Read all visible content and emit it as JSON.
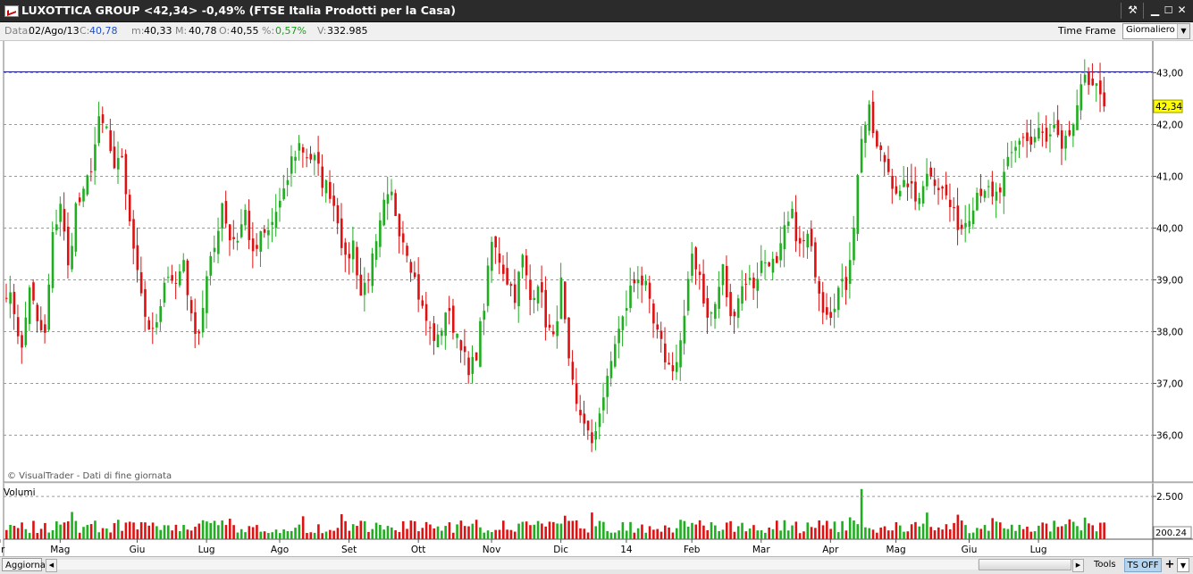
{
  "window": {
    "title": "LUXOTTICA GROUP <42,34> -0,49%  (FTSE Italia Prodotti per la Casa)",
    "buttons": [
      "tools-icon",
      "minimize-icon",
      "maximize-icon",
      "close-icon"
    ]
  },
  "info": {
    "data_label": "Data:",
    "data_value": "02/Ago/13",
    "close_label": "C:",
    "close_value": "40,78",
    "min_label": "m:",
    "min_value": "40,33",
    "max_label": "M:",
    "max_value": "40,78",
    "open_label": "O:",
    "open_value": "40,55",
    "pct_label": "%:",
    "pct_value": "0,57%",
    "vol_label": "V:",
    "vol_value": "332.985",
    "timeframe_label": "Time Frame",
    "timeframe_value": "Giornaliero"
  },
  "bottom": {
    "aggiorna": "Aggiorna",
    "tools": "Tools",
    "tsoff": "TS OFF",
    "plus": "+"
  },
  "chart_data": [
    {
      "type": "candlestick",
      "title": "",
      "ylim": [
        35.1,
        43.6
      ],
      "y_ticks": [
        "43,00",
        "42,00",
        "41,00",
        "40,00",
        "39,00",
        "38,00",
        "37,00",
        "36,00"
      ],
      "y_tick_values": [
        43,
        42,
        41,
        40,
        39,
        38,
        37,
        36
      ],
      "x_ticks": [
        "r",
        "Mag",
        "Giu",
        "Lug",
        "Ago",
        "Set",
        "Ott",
        "Nov",
        "Dic",
        "14",
        "Feb",
        "Mar",
        "Apr",
        "Mag",
        "Giu",
        "Lug"
      ],
      "x_tick_index": [
        0,
        14,
        34,
        52,
        71,
        89,
        107,
        126,
        144,
        161,
        178,
        196,
        214,
        231,
        250,
        268
      ],
      "last_price_label": "42,34",
      "last_price": 42.34,
      "resistance_level": 43.02,
      "grid": true,
      "colors": {
        "up": "#1fae1f",
        "down": "#dd1111",
        "grid": "#9a9a9a",
        "resistance": "#1a1a8c"
      },
      "watermark": "© VisualTrader - Dati di fine giornata",
      "anchors": [
        [
          0,
          38.8
        ],
        [
          2,
          38.4
        ],
        [
          4,
          37.6
        ],
        [
          6,
          38.9
        ],
        [
          8,
          38.1
        ],
        [
          10,
          37.9
        ],
        [
          12,
          39.8
        ],
        [
          14,
          40.5
        ],
        [
          16,
          39.2
        ],
        [
          18,
          40.4
        ],
        [
          20,
          40.6
        ],
        [
          22,
          41.2
        ],
        [
          24,
          42.0
        ],
        [
          26,
          41.9
        ],
        [
          28,
          41.0
        ],
        [
          30,
          41.4
        ],
        [
          32,
          40.0
        ],
        [
          34,
          39.3
        ],
        [
          36,
          38.3
        ],
        [
          38,
          37.9
        ],
        [
          40,
          38.4
        ],
        [
          42,
          39.2
        ],
        [
          44,
          38.9
        ],
        [
          46,
          39.4
        ],
        [
          48,
          38.2
        ],
        [
          50,
          38.0
        ],
        [
          52,
          39.0
        ],
        [
          54,
          39.6
        ],
        [
          56,
          40.5
        ],
        [
          58,
          39.8
        ],
        [
          60,
          39.8
        ],
        [
          62,
          40.3
        ],
        [
          64,
          39.4
        ],
        [
          66,
          39.8
        ],
        [
          68,
          39.9
        ],
        [
          70,
          40.3
        ],
        [
          72,
          40.6
        ],
        [
          74,
          41.3
        ],
        [
          76,
          41.6
        ],
        [
          78,
          41.4
        ],
        [
          80,
          41.3
        ],
        [
          82,
          40.9
        ],
        [
          84,
          40.7
        ],
        [
          86,
          40.2
        ],
        [
          88,
          39.3
        ],
        [
          90,
          39.7
        ],
        [
          92,
          38.7
        ],
        [
          94,
          39.1
        ],
        [
          96,
          39.6
        ],
        [
          98,
          40.4
        ],
        [
          100,
          40.6
        ],
        [
          102,
          40.0
        ],
        [
          104,
          39.6
        ],
        [
          106,
          39.0
        ],
        [
          108,
          38.4
        ],
        [
          110,
          38.0
        ],
        [
          112,
          37.8
        ],
        [
          114,
          38.4
        ],
        [
          116,
          38.1
        ],
        [
          118,
          37.8
        ],
        [
          120,
          37.1
        ],
        [
          122,
          37.6
        ],
        [
          124,
          38.5
        ],
        [
          126,
          39.7
        ],
        [
          128,
          39.4
        ],
        [
          130,
          39.0
        ],
        [
          132,
          38.7
        ],
        [
          134,
          39.4
        ],
        [
          136,
          38.6
        ],
        [
          138,
          39.0
        ],
        [
          140,
          38.2
        ],
        [
          142,
          37.8
        ],
        [
          144,
          38.9
        ],
        [
          146,
          37.3
        ],
        [
          148,
          36.5
        ],
        [
          150,
          36.3
        ],
        [
          152,
          35.7
        ],
        [
          154,
          36.5
        ],
        [
          156,
          37.0
        ],
        [
          158,
          37.8
        ],
        [
          160,
          38.2
        ],
        [
          162,
          38.8
        ],
        [
          164,
          39.1
        ],
        [
          166,
          38.8
        ],
        [
          168,
          38.1
        ],
        [
          170,
          37.7
        ],
        [
          172,
          37.3
        ],
        [
          174,
          37.4
        ],
        [
          176,
          38.2
        ],
        [
          178,
          39.5
        ],
        [
          180,
          39.1
        ],
        [
          182,
          38.2
        ],
        [
          184,
          38.5
        ],
        [
          186,
          39.2
        ],
        [
          188,
          38.2
        ],
        [
          190,
          38.7
        ],
        [
          192,
          39.0
        ],
        [
          194,
          38.9
        ],
        [
          196,
          39.3
        ],
        [
          198,
          39.4
        ],
        [
          200,
          39.2
        ],
        [
          202,
          39.9
        ],
        [
          204,
          40.2
        ],
        [
          206,
          39.6
        ],
        [
          208,
          39.8
        ],
        [
          210,
          39.2
        ],
        [
          212,
          38.5
        ],
        [
          214,
          38.4
        ],
        [
          216,
          38.8
        ],
        [
          218,
          38.9
        ],
        [
          220,
          40.1
        ],
        [
          222,
          41.8
        ],
        [
          224,
          42.2
        ],
        [
          226,
          41.5
        ],
        [
          228,
          41.3
        ],
        [
          230,
          40.9
        ],
        [
          232,
          40.6
        ],
        [
          234,
          40.9
        ],
        [
          236,
          40.5
        ],
        [
          238,
          40.9
        ],
        [
          240,
          41.1
        ],
        [
          242,
          40.8
        ],
        [
          244,
          40.6
        ],
        [
          246,
          40.2
        ],
        [
          248,
          40.0
        ],
        [
          250,
          40.3
        ],
        [
          252,
          40.7
        ],
        [
          254,
          40.8
        ],
        [
          256,
          40.5
        ],
        [
          258,
          40.7
        ],
        [
          260,
          41.2
        ],
        [
          262,
          41.5
        ],
        [
          264,
          41.8
        ],
        [
          266,
          41.6
        ],
        [
          268,
          41.9
        ],
        [
          270,
          41.6
        ],
        [
          272,
          41.9
        ],
        [
          274,
          41.4
        ],
        [
          276,
          41.8
        ],
        [
          278,
          42.2
        ],
        [
          280,
          43.0
        ],
        [
          282,
          42.8
        ],
        [
          284,
          42.5
        ],
        [
          285,
          42.34
        ]
      ],
      "volume_panel": {
        "label": "Volumi",
        "ticks": [
          "2.500"
        ],
        "last_value_label": "200.24",
        "unit": "thousands"
      }
    }
  ]
}
